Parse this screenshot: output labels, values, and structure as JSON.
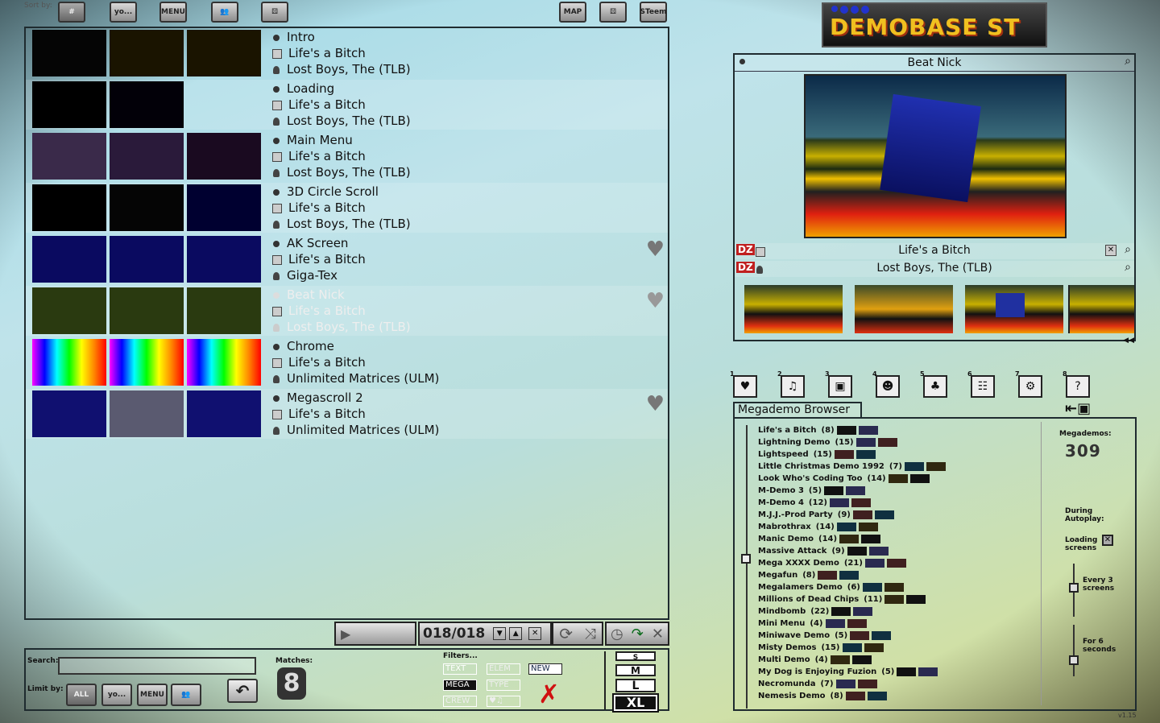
{
  "sortbar": {
    "label": "Sort by:",
    "buttons": [
      "#",
      "yo...",
      "MENU",
      "",
      ""
    ],
    "right_buttons": [
      "MAP",
      "",
      "STeem"
    ]
  },
  "entries": [
    {
      "screen": "Intro",
      "demo": "Life's a Bitch",
      "crew": "Lost Boys, The (TLB)",
      "fav": false,
      "thumbs": [
        "#050505",
        "#1a1400",
        "#1a1400"
      ]
    },
    {
      "screen": "Loading",
      "demo": "Life's a Bitch",
      "crew": "Lost Boys, The (TLB)",
      "fav": false,
      "thumbs": [
        "#000000",
        "#020008",
        "none"
      ]
    },
    {
      "screen": "Main Menu",
      "demo": "Life's a Bitch",
      "crew": "Lost Boys, The (TLB)",
      "fav": false,
      "thumbs": [
        "#3a2a4a",
        "#2a1a3a",
        "#1a0a20"
      ]
    },
    {
      "screen": "3D Circle Scroll",
      "demo": "Life's a Bitch",
      "crew": "Lost Boys, The (TLB)",
      "fav": false,
      "thumbs": [
        "#000000",
        "#050505",
        "#000030"
      ]
    },
    {
      "screen": "AK Screen",
      "demo": "Life's a Bitch",
      "crew": "Giga-Tex",
      "fav": true,
      "thumbs": [
        "#0a0a60",
        "#0a0a60",
        "#0a0a60"
      ]
    },
    {
      "screen": "Beat Nick",
      "demo": "Life's a Bitch",
      "crew": "Lost Boys, The (TLB)",
      "fav": true,
      "selected": true,
      "thumbs": [
        "#2a3a10",
        "#2a3a10",
        "#2a3a10"
      ]
    },
    {
      "screen": "Chrome",
      "demo": "Life's a Bitch",
      "crew": "Unlimited Matrices (ULM)",
      "fav": false,
      "thumbs": [
        "rainbow",
        "rainbow",
        "rainbow"
      ]
    },
    {
      "screen": "Megascroll 2",
      "demo": "Life's a Bitch",
      "crew": "Unlimited Matrices (ULM)",
      "fav": true,
      "thumbs": [
        "#101070",
        "#5a5a70",
        "#101070"
      ]
    }
  ],
  "transport": {
    "counter": "018/018"
  },
  "search": {
    "label": "Search:",
    "value": "",
    "limit_label": "Limit by:",
    "limit_buttons": [
      "ALL",
      "yo...",
      "MENU",
      ""
    ],
    "matches_label": "Matches:",
    "matches": "8"
  },
  "filters": {
    "label": "Filters...",
    "items": [
      "TEXT",
      "ELEM",
      "NEW",
      "MEGA",
      "TYPE",
      "CREW",
      ""
    ]
  },
  "sizes": [
    "S",
    "M",
    "L",
    "XL"
  ],
  "logo": {
    "text": "DEMOBASE ST"
  },
  "viewer": {
    "title": "Beat Nick",
    "demo": "Life's a Bitch",
    "crew": "Lost Boys, The (TLB)",
    "dz": "DZ"
  },
  "categories": [
    "1",
    "2",
    "3",
    "4",
    "5",
    "6",
    "7",
    "8"
  ],
  "browser": {
    "title": "Megademo Browser",
    "megademos_label": "Megademos:",
    "megademos_count": "309",
    "autoplay_label": "During Autoplay:",
    "loading_label": "Loading screens",
    "every_label": "Every 3 screens",
    "for_label": "For 6 seconds",
    "items": [
      {
        "name": "Life's a Bitch",
        "count": "(8)"
      },
      {
        "name": "Lightning Demo",
        "count": "(15)"
      },
      {
        "name": "Lightspeed",
        "count": "(15)"
      },
      {
        "name": "Little Christmas Demo 1992",
        "count": "(7)"
      },
      {
        "name": "Look Who's Coding Too",
        "count": "(14)"
      },
      {
        "name": "M-Demo 3",
        "count": "(5)"
      },
      {
        "name": "M-Demo 4",
        "count": "(12)"
      },
      {
        "name": "M.J.J.-Prod Party",
        "count": "(9)"
      },
      {
        "name": "Mabrothrax",
        "count": "(14)"
      },
      {
        "name": "Manic Demo",
        "count": "(14)"
      },
      {
        "name": "Massive Attack",
        "count": "(9)"
      },
      {
        "name": "Mega XXXX Demo",
        "count": "(21)"
      },
      {
        "name": "Megafun",
        "count": "(8)"
      },
      {
        "name": "Megalamers Demo",
        "count": "(6)"
      },
      {
        "name": "Millions of Dead Chips",
        "count": "(11)"
      },
      {
        "name": "Mindbomb",
        "count": "(22)"
      },
      {
        "name": "Mini Menu",
        "count": "(4)"
      },
      {
        "name": "Miniwave Demo",
        "count": "(5)"
      },
      {
        "name": "Misty Demos",
        "count": "(15)"
      },
      {
        "name": "Multi Demo",
        "count": "(4)"
      },
      {
        "name": "My Dog is Enjoying Fuzion",
        "count": "(5)"
      },
      {
        "name": "Necromunda",
        "count": "(7)"
      },
      {
        "name": "Nemesis Demo",
        "count": "(8)"
      }
    ]
  },
  "version": "v1.15"
}
